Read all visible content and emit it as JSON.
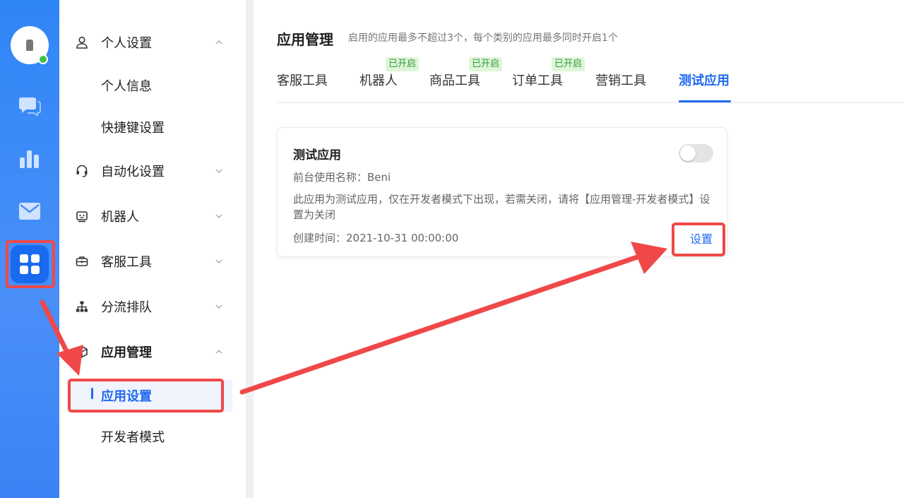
{
  "rail": {
    "icons": [
      "user-avatar",
      "chat-icon",
      "chart-icon",
      "mail-icon",
      "apps-icon"
    ],
    "accent": "#2f86f7"
  },
  "menu": {
    "items": [
      {
        "label": "个人设置",
        "icon": "user-icon",
        "expanded": true
      },
      {
        "label": "自动化设置",
        "icon": "headset-icon",
        "expanded": false
      },
      {
        "label": "机器人",
        "icon": "robot-icon",
        "expanded": false
      },
      {
        "label": "客服工具",
        "icon": "briefcase-icon",
        "expanded": false
      },
      {
        "label": "分流排队",
        "icon": "org-chart-icon",
        "expanded": false
      },
      {
        "label": "应用管理",
        "icon": "cube-icon",
        "expanded": true
      }
    ],
    "personal_sub": [
      "个人信息",
      "快捷键设置"
    ],
    "app_sub": [
      "应用设置",
      "开发者模式"
    ],
    "active_sub": "应用设置"
  },
  "main": {
    "title": "应用管理",
    "hint": "启用的应用最多不超过3个，每个类别的应用最多同时开启1个",
    "tabs": [
      {
        "label": "客服工具",
        "badge": ""
      },
      {
        "label": "机器人",
        "badge": "已开启"
      },
      {
        "label": "商品工具",
        "badge": "已开启"
      },
      {
        "label": "订单工具",
        "badge": "已开启"
      },
      {
        "label": "营销工具",
        "badge": ""
      },
      {
        "label": "测试应用",
        "badge": "",
        "active": true
      }
    ],
    "card": {
      "title": "测试应用",
      "enabled": false,
      "frontend_name": "前台使用名称：Beni",
      "description": "此应用为测试应用，仅在开发者模式下出现，若需关闭，请将【应用管理-开发者模式】设置为关闭",
      "created": "创建时间：2021-10-31 00:00:00",
      "action": "设置"
    }
  },
  "colors": {
    "primary": "#1f6af0",
    "badge_text": "#2e9d3a",
    "badge_bg": "#dff5d8",
    "annotation": "#f04848"
  }
}
